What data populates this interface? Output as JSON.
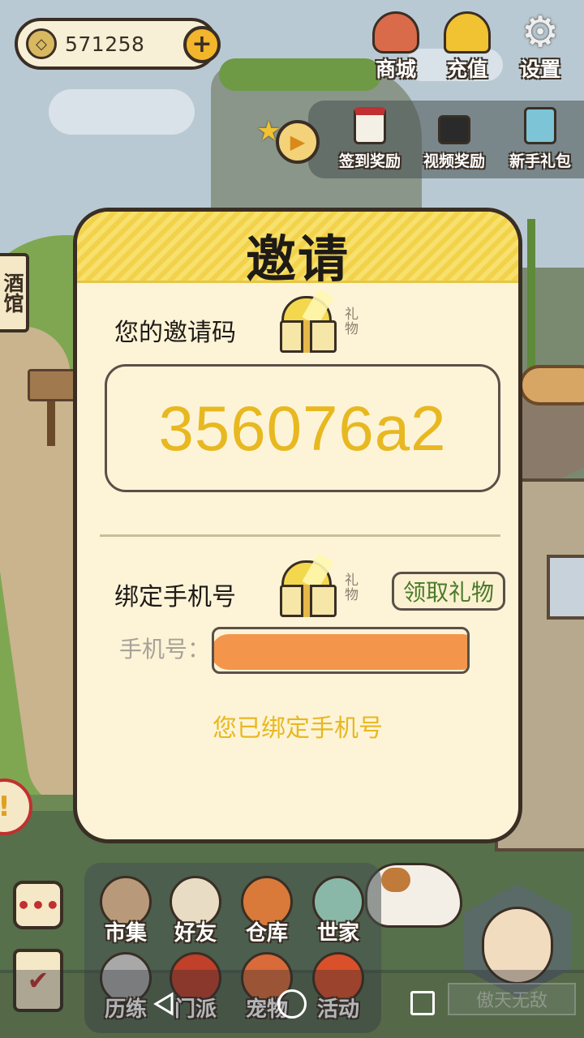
{
  "hud": {
    "coins": "571258",
    "coin_icon": "coin-icon",
    "add_icon": "plus-icon",
    "top_buttons": [
      {
        "label": "商城",
        "icon": "shop-bag-icon"
      },
      {
        "label": "充值",
        "icon": "gold-ingot-icon"
      },
      {
        "label": "设置",
        "icon": "gear-icon"
      }
    ],
    "quick_buttons": [
      {
        "label": "签到奖励",
        "icon": "calendar-icon"
      },
      {
        "label": "视频奖励",
        "icon": "clapperboard-icon"
      },
      {
        "label": "新手礼包",
        "icon": "treasure-chest-icon"
      }
    ],
    "side_tag": "酒馆",
    "alert_symbol": "!"
  },
  "dialog": {
    "title": "邀请",
    "invite_code_label": "您的邀请码",
    "gift_tag": "礼物",
    "invite_code": "356076a2",
    "bind_phone_label": "绑定手机号",
    "claim_button": "领取礼物",
    "phone_label": "手机号：",
    "bound_status": "您已绑定手机号"
  },
  "bottom_menu": {
    "items": [
      {
        "label": "市集",
        "icon": "market-icon"
      },
      {
        "label": "好友",
        "icon": "handshake-icon"
      },
      {
        "label": "仓库",
        "icon": "chest-icon"
      },
      {
        "label": "世家",
        "icon": "armor-icon"
      },
      {
        "label": "历练",
        "icon": "swords-icon"
      },
      {
        "label": "门派",
        "icon": "banner-icon"
      },
      {
        "label": "宠物",
        "icon": "paw-icon"
      },
      {
        "label": "活动",
        "icon": "lantern-icon"
      }
    ],
    "chat_symbol": "•••",
    "player_name": "傲天无敌"
  },
  "colors": {
    "accent_yellow": "#e8b820",
    "claim_green": "#4a7a2a",
    "dialog_bg": "#fdf4d8",
    "outline": "#3a2e24"
  }
}
